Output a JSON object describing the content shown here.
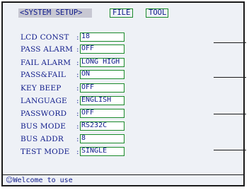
{
  "menu": {
    "active_tab": "<SYSTEM SETUP>",
    "file_tab": "FILE",
    "tool_tab": "TOOL"
  },
  "settings": [
    {
      "label": "LCD CONST",
      "value": "18"
    },
    {
      "label": "PASS ALARM",
      "value": "OFF"
    },
    {
      "label": "FAIL ALARM",
      "value": "LONG HIGH"
    },
    {
      "label": "PASS&FAIL",
      "value": "ON"
    },
    {
      "label": "KEY BEEP",
      "value": "OFF"
    },
    {
      "label": "LANGUAGE",
      "value": "ENGLISH"
    },
    {
      "label": "PASSWORD",
      "value": "OFF"
    },
    {
      "label": "BUS MODE",
      "value": "RS232C"
    },
    {
      "label": "BUS ADDR",
      "value": " 8"
    },
    {
      "label": "TEST MODE",
      "value": "SINGLE"
    }
  ],
  "separator": ":",
  "footer": {
    "icon": "smiley-icon",
    "text": "Welcome to use"
  }
}
